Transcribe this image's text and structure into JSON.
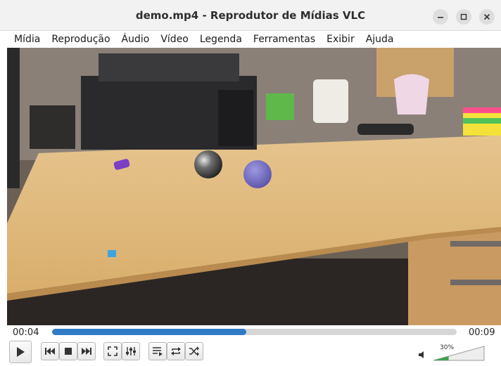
{
  "window": {
    "title": "demo.mp4 - Reprodutor de Mídias VLC"
  },
  "menu": [
    {
      "label": "Mídia",
      "name": "menu-midia"
    },
    {
      "label": "Reprodução",
      "name": "menu-reproducao"
    },
    {
      "label": "Áudio",
      "name": "menu-audio"
    },
    {
      "label": "Vídeo",
      "name": "menu-video"
    },
    {
      "label": "Legenda",
      "name": "menu-legenda"
    },
    {
      "label": "Ferramentas",
      "name": "menu-ferramentas"
    },
    {
      "label": "Exibir",
      "name": "menu-exibir"
    },
    {
      "label": "Ajuda",
      "name": "menu-ajuda"
    }
  ],
  "playback": {
    "elapsed": "00:04",
    "total": "00:09",
    "progress_fraction": 0.48
  },
  "volume": {
    "percent_label": "30%",
    "level_fraction": 0.3
  },
  "colors": {
    "accent": "#2f7ac5",
    "volume_fill": "#3fa34d",
    "titlebar": "#f2f2f2"
  },
  "icons": {
    "play": "play-icon",
    "previous": "previous-icon",
    "stop": "stop-icon",
    "next": "next-icon",
    "fullscreen": "fullscreen-icon",
    "extended_settings": "extended-settings-icon",
    "playlist": "playlist-icon",
    "loop": "loop-icon",
    "random": "random-icon",
    "volume": "speaker-icon"
  }
}
